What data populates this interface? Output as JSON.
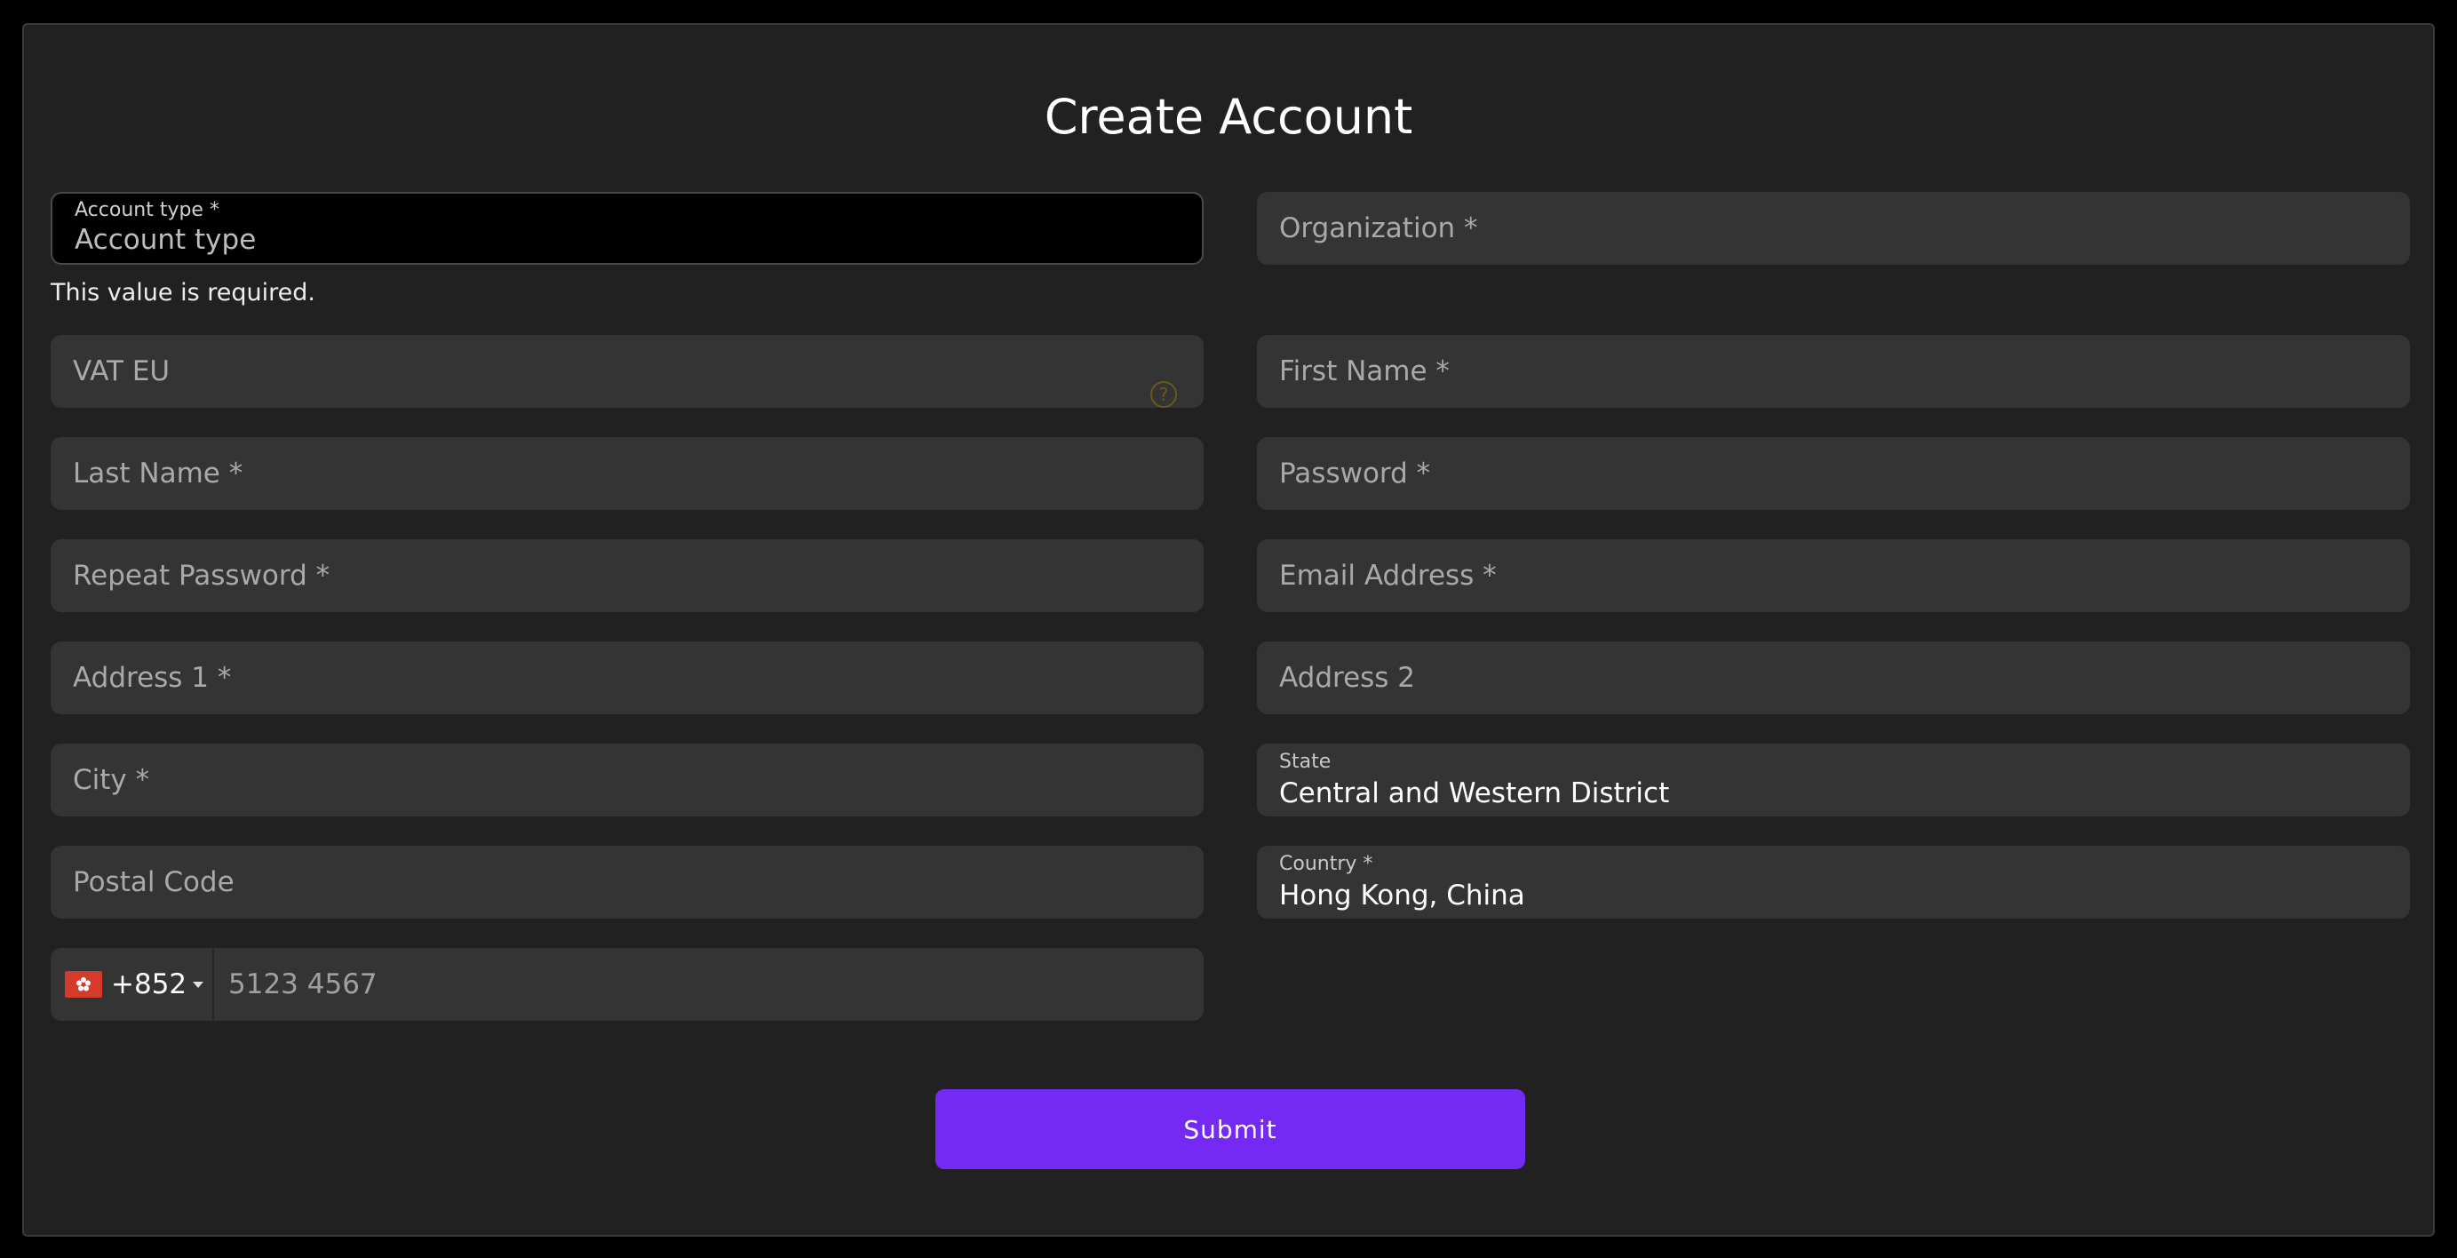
{
  "form": {
    "title": "Create Account",
    "error_message": "This value is required.",
    "submit_label": "Submit"
  },
  "fields": {
    "account_type": {
      "label": "Account type *",
      "placeholder": "Account type"
    },
    "organization": {
      "placeholder": "Organization *"
    },
    "vat_eu": {
      "placeholder": "VAT EU",
      "help_glyph": "?"
    },
    "first_name": {
      "placeholder": "First Name *"
    },
    "last_name": {
      "placeholder": "Last Name *"
    },
    "password": {
      "placeholder": "Password *"
    },
    "repeat_password": {
      "placeholder": "Repeat Password *"
    },
    "email": {
      "placeholder": "Email Address *"
    },
    "address1": {
      "placeholder": "Address 1 *"
    },
    "address2": {
      "placeholder": "Address 2"
    },
    "city": {
      "placeholder": "City *"
    },
    "state": {
      "label": "State",
      "value": "Central and Western District"
    },
    "postal_code": {
      "placeholder": "Postal Code"
    },
    "country": {
      "label": "Country *",
      "value": "Hong Kong, China"
    },
    "phone": {
      "dial_code": "+852",
      "placeholder": "5123 4567",
      "flag_icon": "hong-kong-flag-icon"
    }
  },
  "colors": {
    "background": "#000000",
    "card": "#212121",
    "field": "#343434",
    "accent": "#7429f5",
    "help_icon": "#6a5620"
  }
}
